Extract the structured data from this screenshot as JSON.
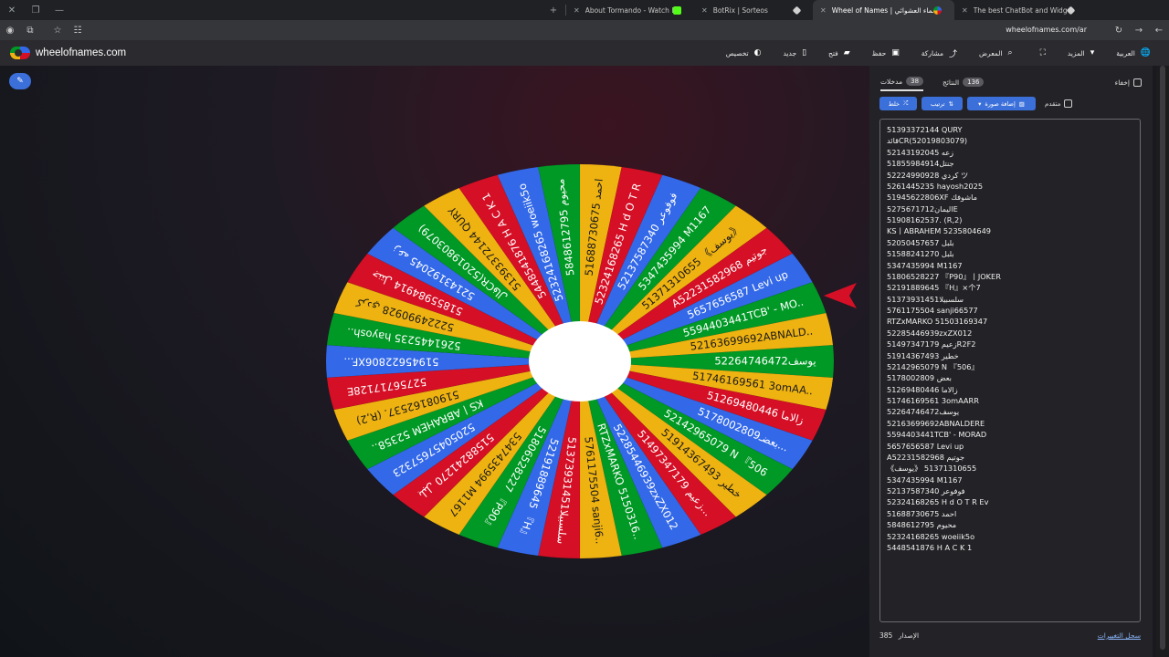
{
  "browser": {
    "tabs": [
      {
        "label": "",
        "icon": "new-tab",
        "color": "#c8c8c8"
      },
      {
        "label": "About Tormando - Watch Live",
        "icon": "kick-logo",
        "color": "#53fc18"
      },
      {
        "label": "BotRix | Sorteos",
        "icon": "botrix-logo",
        "color": "#8a8a8a"
      },
      {
        "label": "Wheel of Names | عجلة الأسماء العشوائي",
        "icon": "wheel-logo",
        "color": "#4a90e2",
        "active": true
      },
      {
        "label": "The best ChatBot and Widgets",
        "icon": "botrix-logo",
        "color": "#8a8a8a"
      }
    ],
    "url": "wheelofnames.com/ar"
  },
  "header": {
    "site_name": "wheelofnames.com",
    "menu": [
      {
        "label": "العربية",
        "icon": "globe-icon",
        "glyph": "🌐"
      },
      {
        "label": "المزيد",
        "icon": "chevron-down-icon",
        "glyph": "▾"
      },
      {
        "label": "",
        "icon": "fullscreen-icon",
        "glyph": "⛶"
      },
      {
        "label": "المعرض",
        "icon": "search-icon",
        "glyph": "⌕"
      },
      {
        "label": "مشاركة",
        "icon": "share-icon",
        "glyph": "⤴"
      },
      {
        "label": "حفظ",
        "icon": "save-icon",
        "glyph": "▣"
      },
      {
        "label": "فتح",
        "icon": "folder-icon",
        "glyph": "▰"
      },
      {
        "label": "جديد",
        "icon": "new-file-icon",
        "glyph": "▯"
      },
      {
        "label": "تخصيص",
        "icon": "palette-icon",
        "glyph": "◐"
      }
    ]
  },
  "wheel": {
    "colors": [
      "#009925",
      "#eeb211",
      "#d50f25",
      "#3369e8"
    ],
    "pointer_color": "#d50f25",
    "hub_color": "#ffffff",
    "slice_labels": [
      "يوسف52264746472",
      "51746169561 3omAA..",
      "51269480446 زالاما",
      "5178002809بعضـ...",
      "52142965079 N 『506",
      "51914367493 خطير",
      "51497347179 زعيم...",
      "52285446939zxZX012",
      "RTZxMARKO 5150316..",
      "5761175504 sanji6..",
      "51373931451سلسبيلا",
      "52191889645 『H』",
      "51806528227 『P90』",
      "5347435994 M1167",
      "51588241270 بلبل",
      "52050457657323",
      "KS丨ABRAHEM 52358..",
      "51908162537. (R,2)",
      "52756717128E",
      "51945622806XF...",
      "5261445235 hayosh..",
      "52224990928 كردي",
      "51855984914 جنتل",
      "52143192045 زعه",
      "فالCR(52019803079)",
      "51393372144 QURY",
      "5448541876 H A C K 1",
      "52324168265 woeiik5o",
      "5848612795 محيوم",
      "51688730675 احمد",
      "52324168265 H d O T R",
      "52137587340 فوفوعر",
      "5347435994 M1167",
      "51371310655 《يوسف》",
      "A52231582968 جوتيم",
      "5657656587 Levi up",
      "5594403441TCB' - MO..",
      "52163699692ABNALD.."
    ]
  },
  "panel": {
    "hide_label": "إخفاء",
    "tab_entries": {
      "label": "مدخلات",
      "count": "38"
    },
    "tab_results": {
      "label": "النتائج",
      "count": "136"
    },
    "buttons": {
      "shuffle": "خلط",
      "sort": "ترتيب",
      "add_image": "إضافة صورة"
    },
    "advanced_label": "متقدم",
    "entries": [
      "51393372144 QURY",
      "قائدCR(52019803079)",
      "52143192045 زعه",
      "51855984914جنتل",
      "52224990928 كردي ツ",
      "5261445235 hayosh2025",
      "51945622806XF ماشوفك",
      "5275671712اليمانE",
      "51908162537. (R,2)",
      "KS丨ABRAHEM 5235804649",
      "52050457657 بلبل",
      "51588241270 بلبل",
      "5347435994 M1167",
      "51806528227 『P90』丨JOKER",
      "52191889645 『H』×个7",
      "51373931451سلسبيلا",
      "5761175504 sanji66577",
      "RTZxMARKO 51503169347",
      "52285446939zxZX012",
      "51497347179 زعيمR2F2",
      "51914367493 خطير",
      "52142965079 N 『506』",
      "5178002809 بعض",
      "51269480446 زالاما",
      "51746169561 3omAARR",
      "52264746472يوسف",
      "52163699692ABNALDERE",
      "5594403441TCB' - MORAD",
      "5657656587 Levi up",
      "A52231582968 جوتيم",
      "《يوسف》 51371310655",
      "5347435994 M1167",
      "52137587340 فوفوعر",
      "52324168265 H d O T R Ev",
      "51688730675 احمد",
      "5848612795 محيوم",
      "52324168265 woeiik5o",
      "5448541876 H A C K 1"
    ],
    "version_label": "الإصدار",
    "version_number": "385",
    "changelog_label": "سجل التغييرات"
  }
}
